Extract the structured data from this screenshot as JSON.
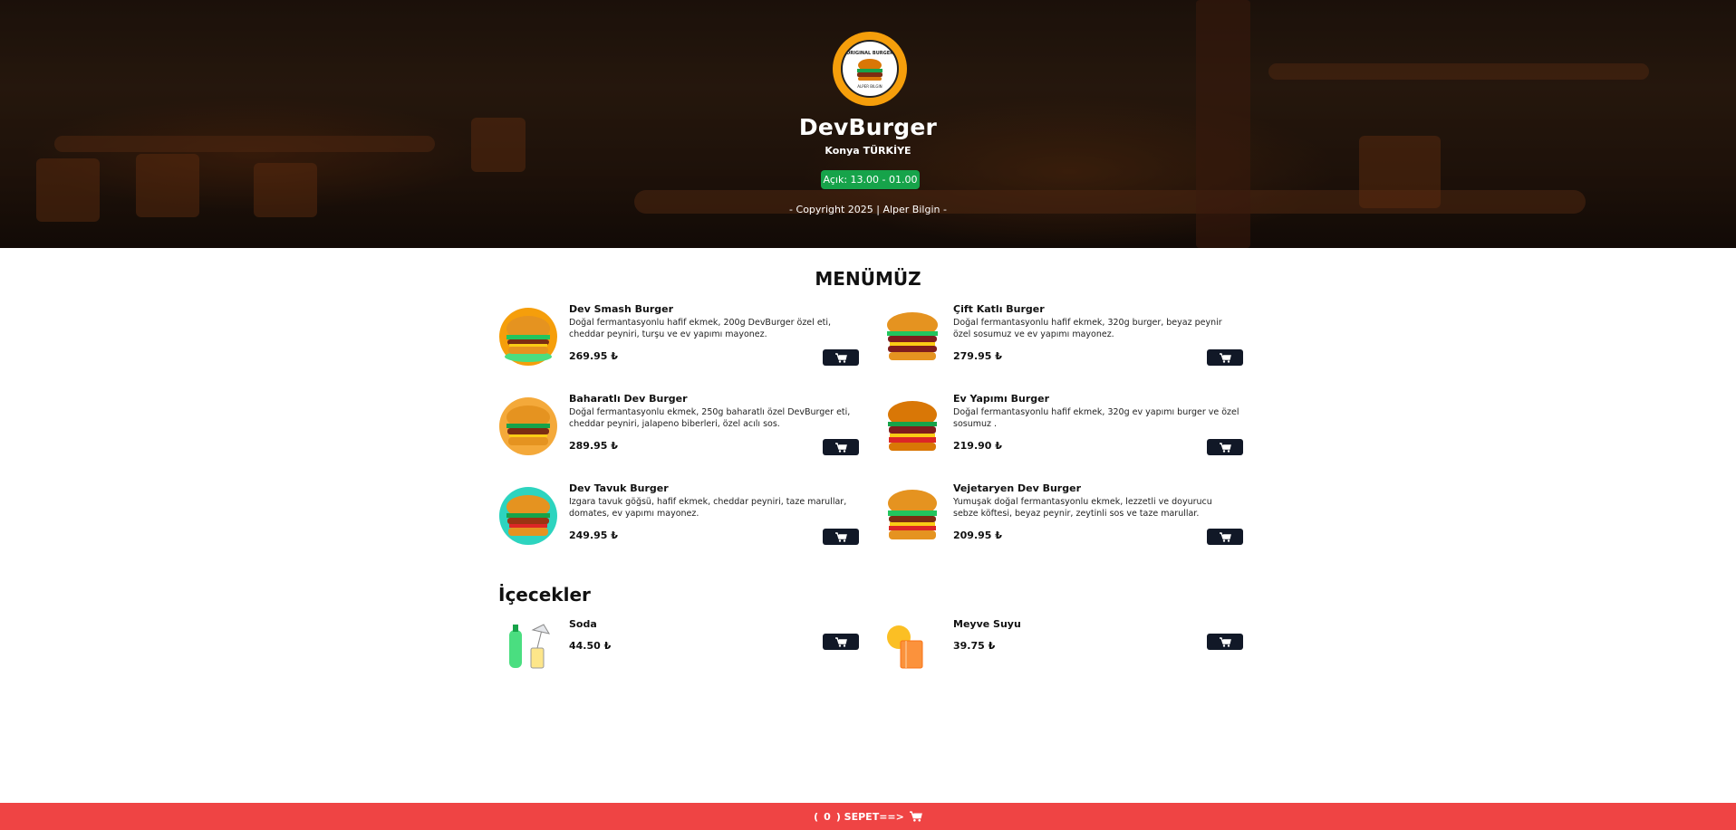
{
  "hero": {
    "title": "DevBurger",
    "subtitle": "Konya TÜRKİYE",
    "status": "Açık: 13.00 - 01.00",
    "copyright": "- Copyright 2025 | Alper Bilgin -",
    "logo_text": "ORIGINAL BURGER",
    "logo_subtext": "ALPER BILGIN"
  },
  "menu": {
    "title": "MENÜMÜZ",
    "items": [
      {
        "name": "Dev Smash Burger",
        "desc": "Doğal fermantasyonlu hafif ekmek, 200g DevBurger özel eti, cheddar peyniri, turşu ve ev yapımı mayonez.",
        "price": "269.95 ₺"
      },
      {
        "name": "Çift Katlı Burger",
        "desc": "Doğal fermantasyonlu hafif ekmek, 320g burger, beyaz peynir özel sosumuz ve ev yapımı mayonez.",
        "price": "279.95 ₺"
      },
      {
        "name": "Baharatlı Dev Burger",
        "desc": "Doğal fermantasyonlu ekmek, 250g baharatlı özel DevBurger eti, cheddar peyniri, jalapeno biberleri, özel acılı sos.",
        "price": "289.95 ₺"
      },
      {
        "name": "Ev Yapımı Burger",
        "desc": "Doğal fermantasyonlu hafif ekmek, 320g ev yapımı burger ve özel sosumuz .",
        "price": "219.90 ₺"
      },
      {
        "name": "Dev Tavuk Burger",
        "desc": "Izgara tavuk göğsü, hafif ekmek, cheddar peyniri, taze marullar, domates, ev yapımı mayonez.",
        "price": "249.95 ₺"
      },
      {
        "name": "Vejetaryen Dev Burger",
        "desc": "Yumuşak doğal fermantasyonlu ekmek, lezzetli ve doyurucu sebze köftesi, beyaz peynir, zeytinli sos ve taze marullar.",
        "price": "209.95 ₺"
      }
    ]
  },
  "drinks": {
    "title": "İçecekler",
    "items": [
      {
        "name": "Soda",
        "price": "44.50 ₺"
      },
      {
        "name": "Meyve Suyu",
        "price": "39.75 ₺"
      }
    ]
  },
  "cart": {
    "count": "0",
    "label": ") SEPET==>"
  },
  "colors": {
    "accent": "#f59e0b",
    "status": "#16a34a",
    "button": "#111827",
    "cart_bar": "#ef4444"
  },
  "icons": {
    "cart": "cart-icon"
  }
}
